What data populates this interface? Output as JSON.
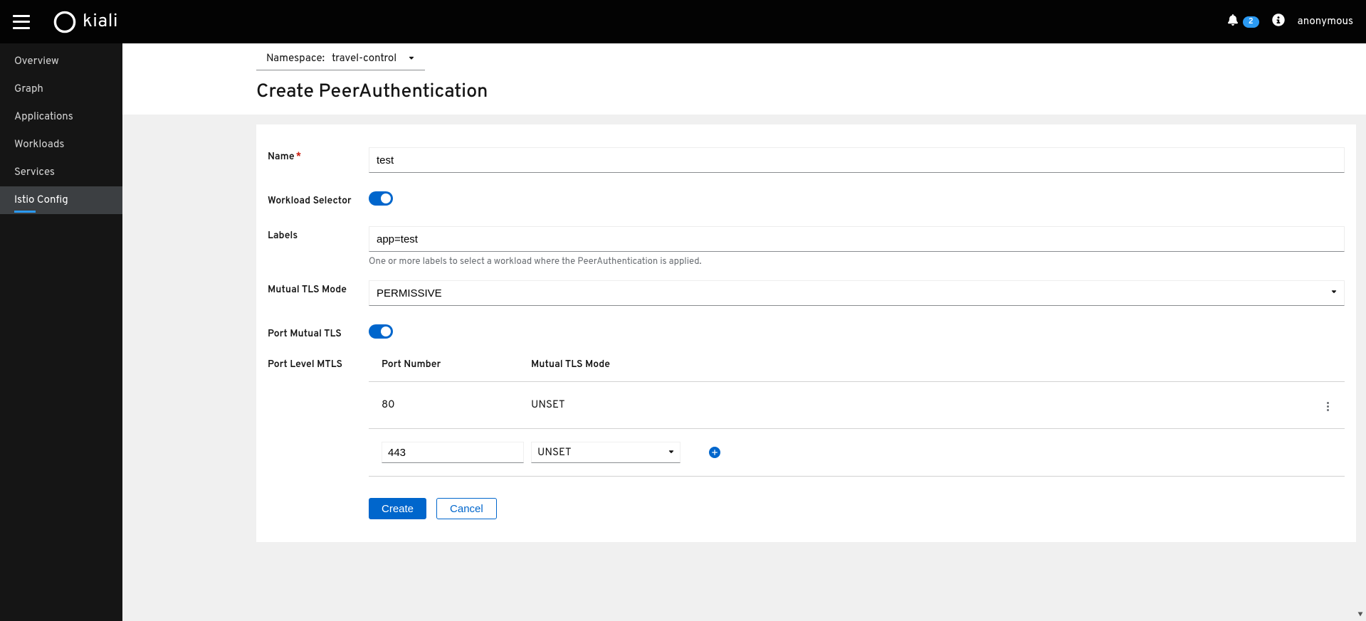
{
  "brand": "kiali",
  "notifications": {
    "count": "2"
  },
  "user": "anonymous",
  "sidebar": {
    "items": [
      {
        "label": "Overview"
      },
      {
        "label": "Graph"
      },
      {
        "label": "Applications"
      },
      {
        "label": "Workloads"
      },
      {
        "label": "Services"
      },
      {
        "label": "Istio Config"
      }
    ]
  },
  "namespace": {
    "label": "Namespace:",
    "value": "travel-control"
  },
  "page_title": "Create PeerAuthentication",
  "form": {
    "name_label": "Name",
    "name_value": "test",
    "workload_selector_label": "Workload Selector",
    "workload_selector_on": true,
    "labels_label": "Labels",
    "labels_value": "app=test",
    "labels_helper": "One or more labels to select a workload where the PeerAuthentication is applied.",
    "mtls_mode_label": "Mutual TLS Mode",
    "mtls_mode_value": "PERMISSIVE",
    "port_mtls_label": "Port Mutual TLS",
    "port_mtls_on": true,
    "port_level_label": "Port Level MTLS",
    "port_table": {
      "headers": {
        "port": "Port Number",
        "mode": "Mutual TLS Mode"
      },
      "rows": [
        {
          "port": "80",
          "mode": "UNSET"
        }
      ],
      "new_row": {
        "port": "443",
        "mode": "UNSET"
      }
    }
  },
  "actions": {
    "create": "Create",
    "cancel": "Cancel"
  }
}
